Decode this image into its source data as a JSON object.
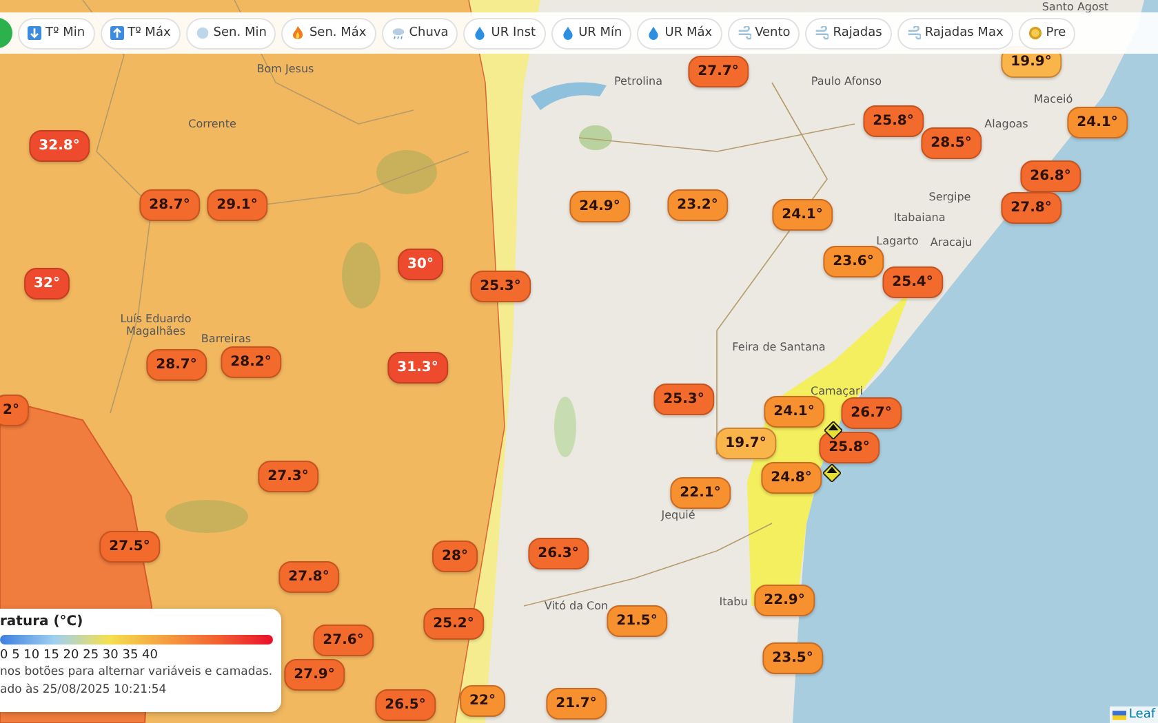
{
  "toolbar": {
    "buttons": [
      {
        "label": "Tº Min",
        "kind": "arrow-down"
      },
      {
        "label": "Tº Máx",
        "kind": "arrow-up"
      },
      {
        "label": "Sen. Min",
        "kind": "snow"
      },
      {
        "label": "Sen. Máx",
        "kind": "fire"
      },
      {
        "label": "Chuva",
        "kind": "rain"
      },
      {
        "label": "UR Inst",
        "kind": "drop"
      },
      {
        "label": "UR Mín",
        "kind": "drop"
      },
      {
        "label": "UR Máx",
        "kind": "drop"
      },
      {
        "label": "Vento",
        "kind": "wind"
      },
      {
        "label": "Rajadas",
        "kind": "wind"
      },
      {
        "label": "Rajadas Max",
        "kind": "wind"
      },
      {
        "label": "Pre",
        "kind": "coin"
      }
    ]
  },
  "places": [
    "Santo Agost",
    "Bom Jesus",
    "Corrente",
    "Luís Eduardo Magalhães",
    "Barreiras",
    "Petrolina",
    "Paulo Afonso",
    "Alagoas",
    "Maceió",
    "Sergipe",
    "Itabaiana",
    "Lagarto",
    "Aracaju",
    "Feira de Santana",
    "Camaçari",
    "Jequié",
    "Vitó da Con",
    "Itabu"
  ],
  "markers": [
    {
      "value": "27.7°",
      "color": "#f26a2c"
    },
    {
      "value": "19.9°",
      "color": "#f9b44a"
    },
    {
      "value": "25.8°",
      "color": "#f26a2c"
    },
    {
      "value": "24.1°",
      "color": "#f7902f"
    },
    {
      "value": "32.8°",
      "color": "#ee4a2e"
    },
    {
      "value": "28.5°",
      "color": "#f26a2c"
    },
    {
      "value": "26.8°",
      "color": "#f26a2c"
    },
    {
      "value": "28.7°",
      "color": "#f26a2c"
    },
    {
      "value": "29.1°",
      "color": "#f26a2c"
    },
    {
      "value": "24.9°",
      "color": "#f7902f"
    },
    {
      "value": "23.2°",
      "color": "#f7902f"
    },
    {
      "value": "24.1°",
      "color": "#f7902f"
    },
    {
      "value": "27.8°",
      "color": "#f26a2c"
    },
    {
      "value": "30°",
      "color": "#ee4a2e"
    },
    {
      "value": "23.6°",
      "color": "#f7902f"
    },
    {
      "value": "32°",
      "color": "#ee4a2e"
    },
    {
      "value": "25.3°",
      "color": "#f26a2c"
    },
    {
      "value": "25.4°",
      "color": "#f26a2c"
    },
    {
      "value": "28.7°",
      "color": "#f26a2c"
    },
    {
      "value": "28.2°",
      "color": "#f26a2c"
    },
    {
      "value": "31.3°",
      "color": "#ee4a2e"
    },
    {
      "value": "2°",
      "color": "#f26a2c"
    },
    {
      "value": "25.3°",
      "color": "#f26a2c"
    },
    {
      "value": "24.1°",
      "color": "#f7902f"
    },
    {
      "value": "26.7°",
      "color": "#f26a2c"
    },
    {
      "value": "19.7°",
      "color": "#f9b44a"
    },
    {
      "value": "25.8°",
      "color": "#f26a2c"
    },
    {
      "value": "27.3°",
      "color": "#f26a2c"
    },
    {
      "value": "24.8°",
      "color": "#f7902f"
    },
    {
      "value": "22.1°",
      "color": "#f7902f"
    },
    {
      "value": "27.5°",
      "color": "#f26a2c"
    },
    {
      "value": "28°",
      "color": "#f26a2c"
    },
    {
      "value": "26.3°",
      "color": "#f26a2c"
    },
    {
      "value": "27.8°",
      "color": "#f26a2c"
    },
    {
      "value": "22.9°",
      "color": "#f7902f"
    },
    {
      "value": "25.2°",
      "color": "#f26a2c"
    },
    {
      "value": "21.5°",
      "color": "#f7902f"
    },
    {
      "value": "27.6°",
      "color": "#f26a2c"
    },
    {
      "value": "23.5°",
      "color": "#f7902f"
    },
    {
      "value": "27.9°",
      "color": "#f26a2c"
    },
    {
      "value": "26.5°",
      "color": "#f26a2c"
    },
    {
      "value": "22°",
      "color": "#f7902f"
    },
    {
      "value": "21.7°",
      "color": "#f7902f"
    }
  ],
  "legend": {
    "title": "ratura (°C)",
    "scale": "0 5 10 15 20 25 30 35 40",
    "hint": "nos botões para alternar variáveis e camadas.",
    "updated": "ado às 25/08/2025 10:21:54"
  },
  "attribution": "Leaf"
}
